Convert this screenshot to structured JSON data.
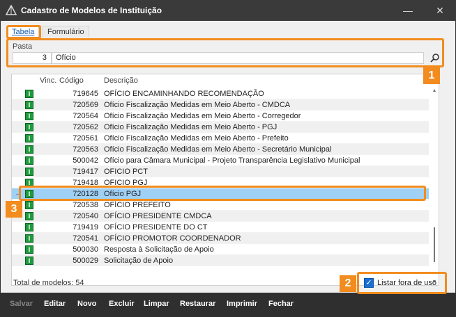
{
  "window": {
    "title": "Cadastro de Modelos de Instituição",
    "minimize_glyph": "—",
    "close_glyph": "✕"
  },
  "tabs": [
    {
      "label": "Tabela",
      "active": true
    },
    {
      "label": "Formulário",
      "active": false
    }
  ],
  "pasta": {
    "label": "Pasta",
    "code": "3",
    "description": "Ofício"
  },
  "grid": {
    "headers": {
      "vinc": "Vinc.",
      "codigo": "Código",
      "descricao": "Descrição"
    },
    "rows": [
      {
        "code": "719645",
        "desc": "OFÍCIO ENCAMINHANDO RECOMENDAÇÃO",
        "selected": false
      },
      {
        "code": "720569",
        "desc": "Ofício Fiscalização Medidas em Meio Aberto - CMDCA",
        "selected": false
      },
      {
        "code": "720564",
        "desc": "Ofício Fiscalização Medidas em Meio Aberto - Corregedor",
        "selected": false
      },
      {
        "code": "720562",
        "desc": "Ofício Fiscalização Medidas em Meio Aberto - PGJ",
        "selected": false
      },
      {
        "code": "720561",
        "desc": "Ofício Fiscalização Medidas em Meio Aberto - Prefeito",
        "selected": false
      },
      {
        "code": "720563",
        "desc": "Ofício Fiscalização Medidas em Meio Aberto - Secretário Municipal",
        "selected": false
      },
      {
        "code": "500042",
        "desc": "Ofício para Câmara Municipal - Projeto Transparência Legislativo Municipal",
        "selected": false
      },
      {
        "code": "719417",
        "desc": "OFICIO PCT",
        "selected": false
      },
      {
        "code": "719418",
        "desc": "OFICIO PGJ",
        "selected": false
      },
      {
        "code": "720128",
        "desc": "Ofício PGJ",
        "selected": true
      },
      {
        "code": "720538",
        "desc": "OFÍCIO PREFEITO",
        "selected": false
      },
      {
        "code": "720540",
        "desc": "OFÍCIO PRESIDENTE CMDCA",
        "selected": false
      },
      {
        "code": "719419",
        "desc": "OFÍCIO PRESIDENTE DO CT",
        "selected": false
      },
      {
        "code": "720541",
        "desc": "OFÍCIO PROMOTOR COORDENADOR",
        "selected": false
      },
      {
        "code": "500030",
        "desc": "Resposta à Solicitação de Apoio",
        "selected": false
      },
      {
        "code": "500029",
        "desc": "Solicitação de Apoio",
        "selected": false
      }
    ],
    "row_badge_glyph": "I",
    "selected_arrow": "→"
  },
  "total_label": "Total de modelos: 54",
  "checkbox": {
    "label": "Listar fora de uso",
    "checked": true,
    "check_glyph": "✓"
  },
  "toolbar": {
    "salvar": "Salvar",
    "editar": "Editar",
    "novo": "Novo",
    "excluir": "Excluir",
    "limpar": "Limpar",
    "restaurar": "Restaurar",
    "imprimir": "Imprimir",
    "fechar": "Fechar"
  },
  "markers": {
    "m1": "1",
    "m2": "2",
    "m3": "3"
  },
  "colors": {
    "accent": "#f28c1e",
    "selection": "#9fd0f5",
    "badge": "#1e9b3c",
    "checkbox": "#1a6fd1"
  }
}
